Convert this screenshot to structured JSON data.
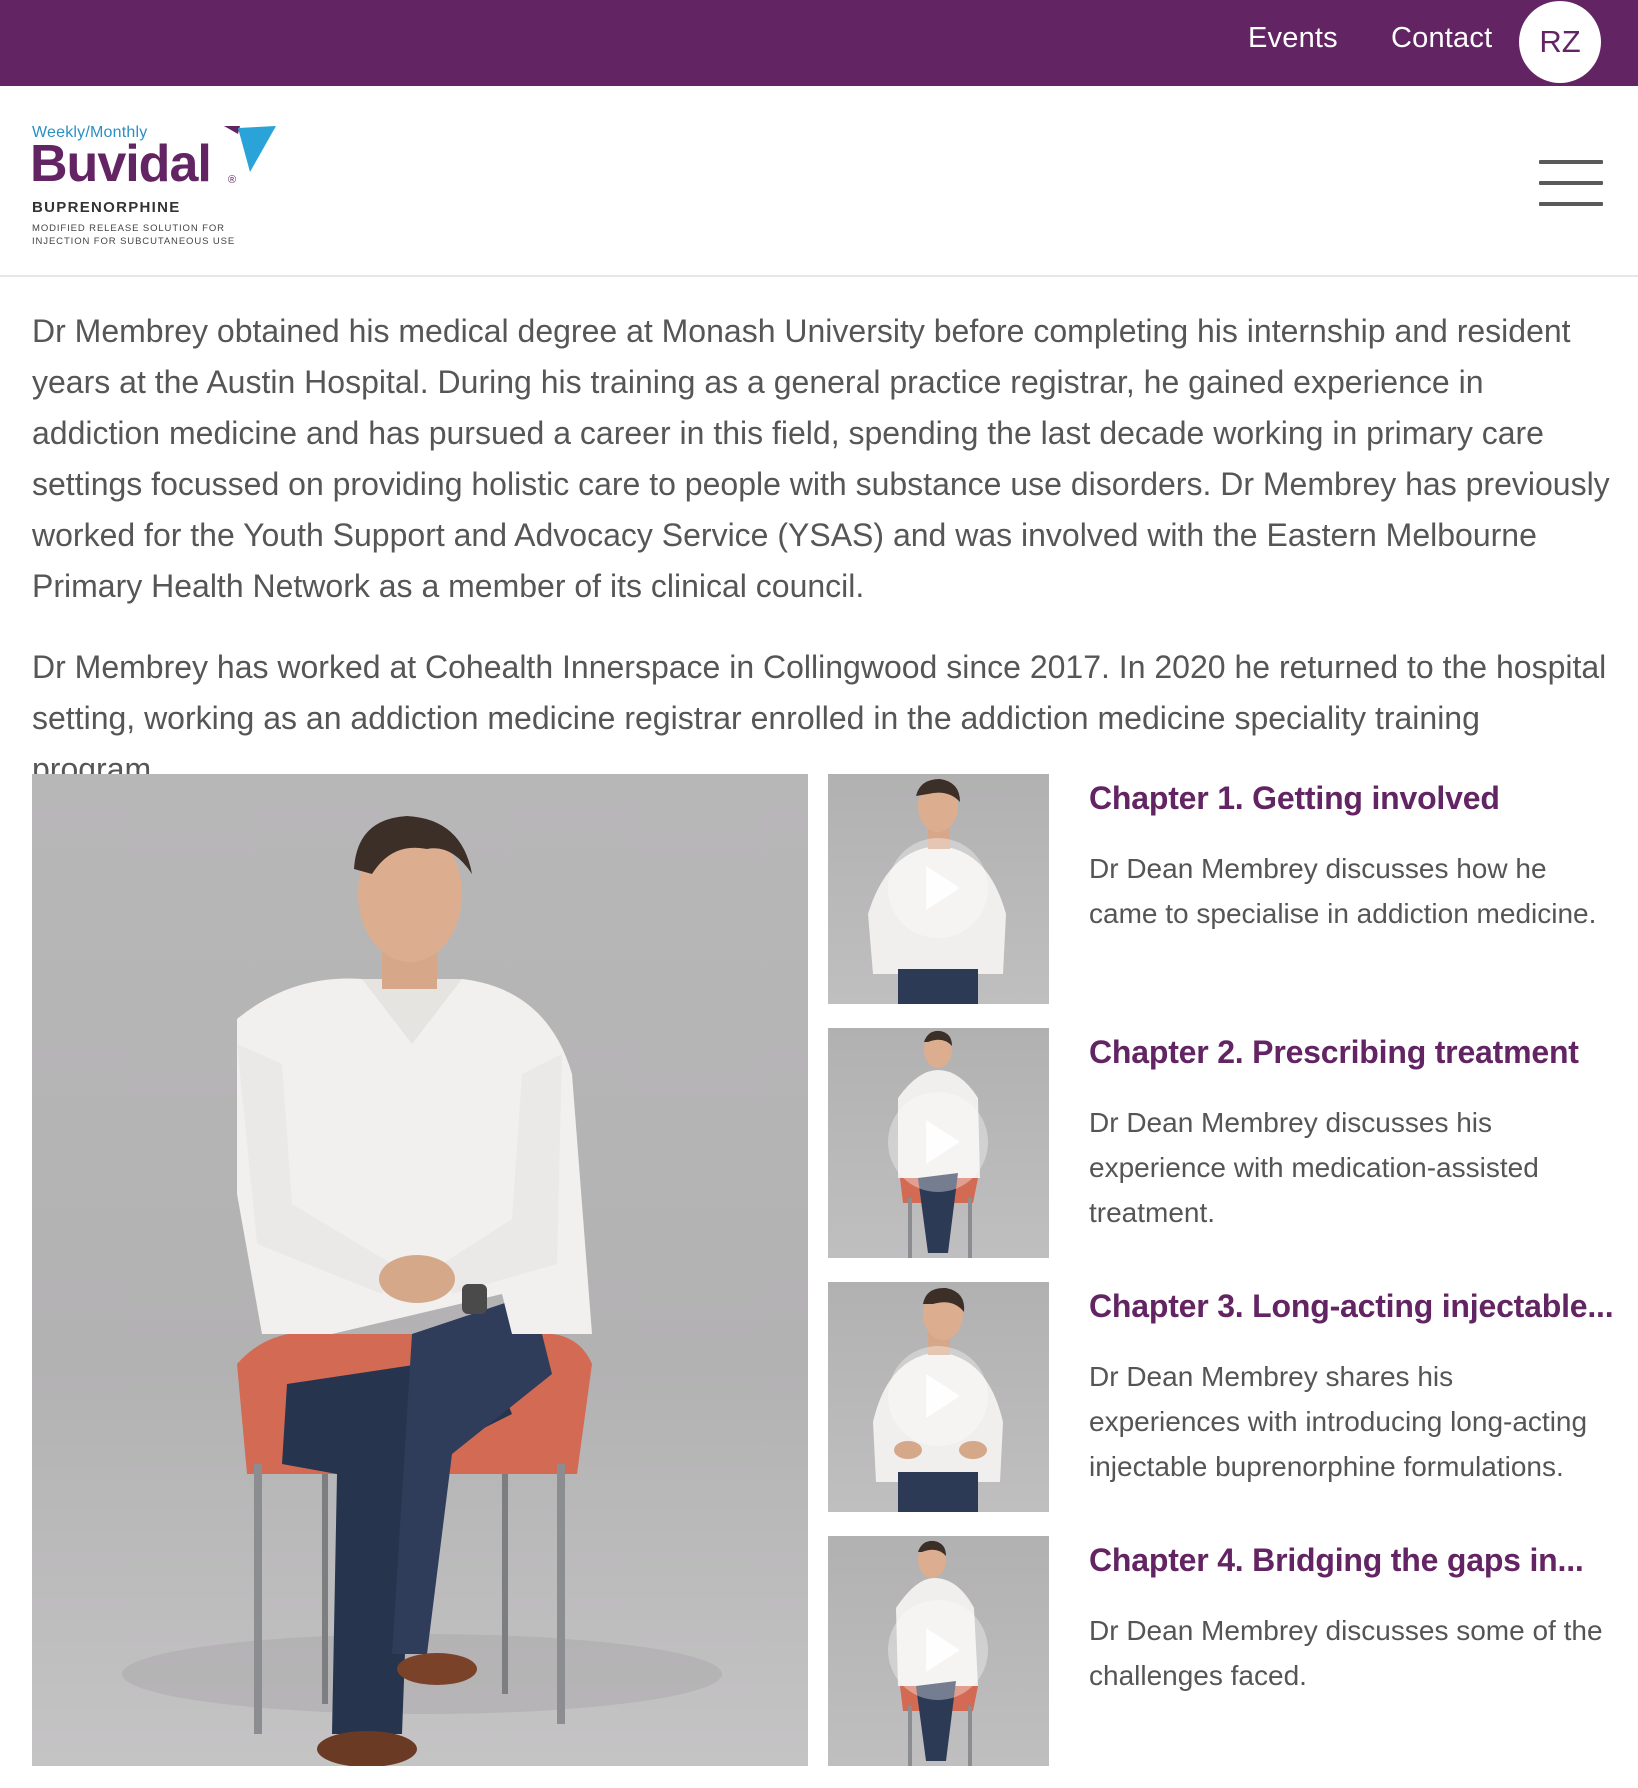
{
  "topbar": {
    "nav": [
      "Events",
      "Contact"
    ],
    "avatar_initials": "RZ",
    "color": "#632463"
  },
  "header": {
    "logo": {
      "tagline": "Weekly/Monthly",
      "brand": "Buvidal",
      "registered": "®",
      "generic_name": "BUPRENORPHINE",
      "description_line1": "MODIFIED RELEASE SOLUTION FOR",
      "description_line2": "INJECTION FOR SUBCUTANEOUS USE"
    },
    "menu_icon": "hamburger-icon"
  },
  "bio": {
    "paragraphs": [
      "Dr Membrey obtained his medical degree at Monash University before completing his internship and resident years at the Austin Hospital. During his training as a general practice registrar, he gained experience in addiction medicine and has pursued a career in this field, spending the last decade working in primary care settings focussed on providing holistic care to people with substance use disorders. Dr Membrey has previously worked for the Youth Support and Advocacy Service (YSAS) and was involved with the Eastern Melbourne Primary Health Network as a member of its clinical council.",
      "Dr Membrey has worked at Cohealth Innerspace in Collingwood since 2017. In 2020 he returned to the hospital setting, working as an addiction medicine registrar enrolled in the addiction medicine speciality training program."
    ]
  },
  "chapters": [
    {
      "title": "Chapter 1. Getting involved",
      "description": "Dr Dean Membrey discusses how he came to specialise in addiction medicine."
    },
    {
      "title": "Chapter 2. Prescribing treatment",
      "description": "Dr Dean Membrey discusses his experience with medication-assisted treatment."
    },
    {
      "title": "Chapter 3. Long-acting injectable...",
      "description": "Dr Dean Membrey shares his experiences with introducing long-acting injectable buprenorphine formulations."
    },
    {
      "title": "Chapter 4. Bridging the gaps in...",
      "description": "Dr Dean Membrey discusses some of the challenges faced."
    }
  ],
  "colors": {
    "brand_purple": "#632463",
    "logo_blue": "#2a8fc5",
    "body_text": "#565656"
  }
}
